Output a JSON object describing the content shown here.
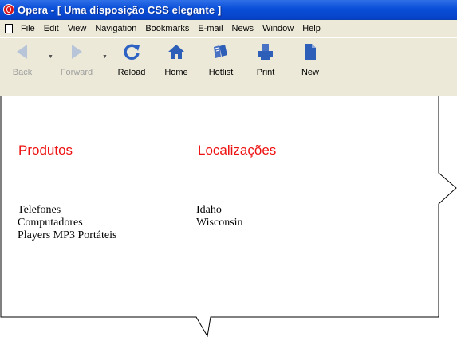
{
  "window": {
    "title": "Opera - [ Uma disposição CSS elegante ]"
  },
  "menu": [
    "File",
    "Edit",
    "View",
    "Navigation",
    "Bookmarks",
    "E-mail",
    "News",
    "Window",
    "Help"
  ],
  "toolbar": {
    "back": "Back",
    "forward": "Forward",
    "reload": "Reload",
    "home": "Home",
    "hotlist": "Hotlist",
    "print": "Print",
    "new": "New"
  },
  "content": {
    "col1": {
      "heading": "Produtos",
      "items": [
        "Telefones",
        "Computadores",
        "Players MP3 Portáteis"
      ]
    },
    "col2": {
      "heading": "Localizações",
      "items": [
        "Idaho",
        "Wisconsin"
      ]
    }
  },
  "colors": {
    "heading": "#ee1111",
    "titlebar": "#0a4fd8",
    "chrome": "#ece9d8"
  }
}
